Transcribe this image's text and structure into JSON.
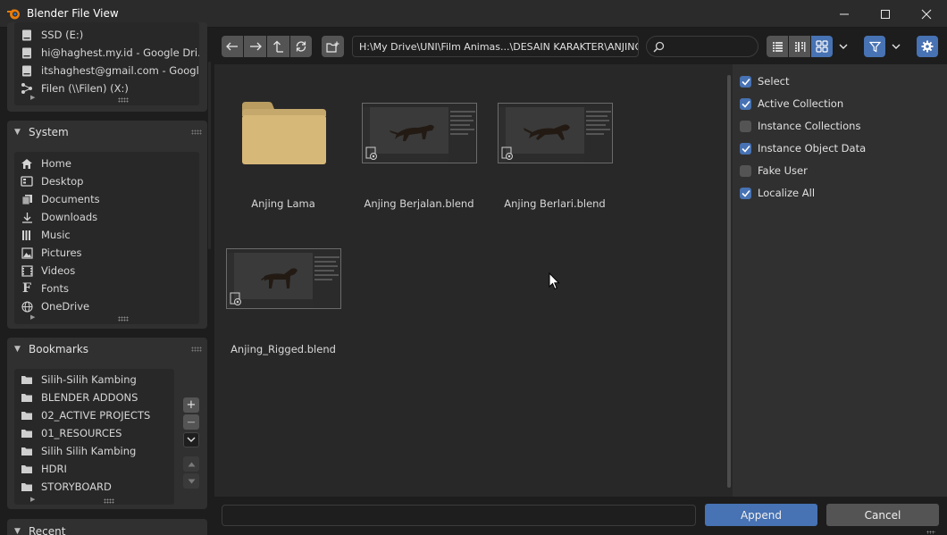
{
  "window": {
    "title": "Blender File View",
    "minimize_glyph": "—",
    "close_glyph": "✕"
  },
  "volumes": {
    "items": [
      {
        "label": "SSD (E:)",
        "icon": "drive-icon"
      },
      {
        "label": "hi@haghest.my.id - Google Dri...",
        "icon": "drive-icon"
      },
      {
        "label": "itshaghest@gmail.com - Googl...",
        "icon": "drive-icon"
      },
      {
        "label": "Filen (\\\\Filen) (X:)",
        "icon": "network-drive-icon"
      }
    ]
  },
  "system": {
    "header": "System",
    "items": [
      {
        "label": "Home",
        "icon": "home-icon"
      },
      {
        "label": "Desktop",
        "icon": "desktop-icon"
      },
      {
        "label": "Documents",
        "icon": "documents-icon"
      },
      {
        "label": "Downloads",
        "icon": "download-icon"
      },
      {
        "label": "Music",
        "icon": "music-icon"
      },
      {
        "label": "Pictures",
        "icon": "pictures-icon"
      },
      {
        "label": "Videos",
        "icon": "videos-icon"
      },
      {
        "label": "Fonts",
        "icon": "fonts-icon"
      },
      {
        "label": "OneDrive",
        "icon": "globe-icon"
      }
    ]
  },
  "bookmarks": {
    "header": "Bookmarks",
    "items": [
      {
        "label": "Silih-Silih Kambing",
        "icon": "folder-icon"
      },
      {
        "label": "BLENDER ADDONS",
        "icon": "folder-icon"
      },
      {
        "label": "02_ACTIVE PROJECTS",
        "icon": "folder-icon"
      },
      {
        "label": "01_RESOURCES",
        "icon": "folder-icon"
      },
      {
        "label": "Silih Silih Kambing",
        "icon": "folder-icon"
      },
      {
        "label": "HDRI",
        "icon": "folder-icon"
      },
      {
        "label": "STORYBOARD",
        "icon": "folder-icon"
      }
    ],
    "add_glyph": "+",
    "remove_glyph": "—"
  },
  "recent": {
    "header": "Recent"
  },
  "toolbar": {
    "path": "H:\\My Drive\\UNI\\Film Animas...\\DESAIN KARAKTER\\ANJING\\",
    "search_value": ""
  },
  "files": [
    {
      "name": "Anjing Lama",
      "type": "folder"
    },
    {
      "name": "Anjing Berjalan.blend",
      "type": "blend"
    },
    {
      "name": "Anjing Berlari.blend",
      "type": "blend"
    },
    {
      "name": "Anjing_Rigged.blend",
      "type": "blend"
    }
  ],
  "options": [
    {
      "label": "Select",
      "checked": true
    },
    {
      "label": "Active Collection",
      "checked": true
    },
    {
      "label": "Instance Collections",
      "checked": false
    },
    {
      "label": "Instance Object Data",
      "checked": true
    },
    {
      "label": "Fake User",
      "checked": false
    },
    {
      "label": "Localize All",
      "checked": true
    }
  ],
  "bottom": {
    "filename_value": "",
    "append_label": "Append",
    "cancel_label": "Cancel"
  },
  "colors": {
    "accent": "#4772b3",
    "folder": "#d6b878",
    "button": "#545454"
  }
}
